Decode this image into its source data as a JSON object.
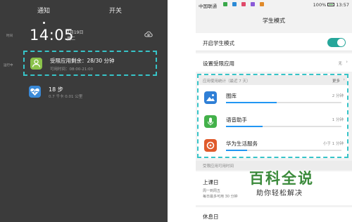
{
  "left_panel": {
    "tabs": {
      "notification": "通知",
      "switches": "开关"
    },
    "time_label": "时间",
    "time": "14:05",
    "date": "7月19日",
    "weekday": "周二",
    "running_label": "运行中",
    "notifications": [
      {
        "title": "受限应用剩余：28/30 分钟",
        "subtitle": "可用时间：08:00-21:00",
        "icon": "person-icon",
        "color": "#8ac24a"
      },
      {
        "title": "18 步",
        "subtitle": "0.7 千卡  0.01 公里",
        "icon": "heart-pulse-icon",
        "color": "#3a8ad8"
      }
    ]
  },
  "right_panel": {
    "status_bar": {
      "carrier": "中国联通",
      "battery": "100%",
      "time": "13:57"
    },
    "title": "学生模式",
    "enable_label": "开启学生模式",
    "enabled": true,
    "restricted_apps_label": "设置受限应用",
    "restricted_apps_value": "无",
    "usage": {
      "header": "应用使用统计（最近 7 天）",
      "more": "更多",
      "apps": [
        {
          "name": "图库",
          "time": "2 分钟",
          "icon": "gallery-icon",
          "color": "#2f7fd6",
          "fill": 0.44
        },
        {
          "name": "语音助手",
          "time": "1 分钟",
          "icon": "microphone-icon",
          "color": "#43b14a",
          "fill": 0.32
        },
        {
          "name": "华为生活服务",
          "time": "小于 1 分钟",
          "icon": "service-icon",
          "color": "#e05a2b",
          "fill": 0.18
        }
      ]
    },
    "time_section_label": "受限应用可用时间",
    "schedule": {
      "title": "上课日",
      "line1": "周一到周五",
      "line2": "每日最多可用 30 分钟"
    },
    "rest_day_label": "休息日"
  },
  "watermark": {
    "title": "百科全说",
    "subtitle": "助你轻松解决"
  }
}
